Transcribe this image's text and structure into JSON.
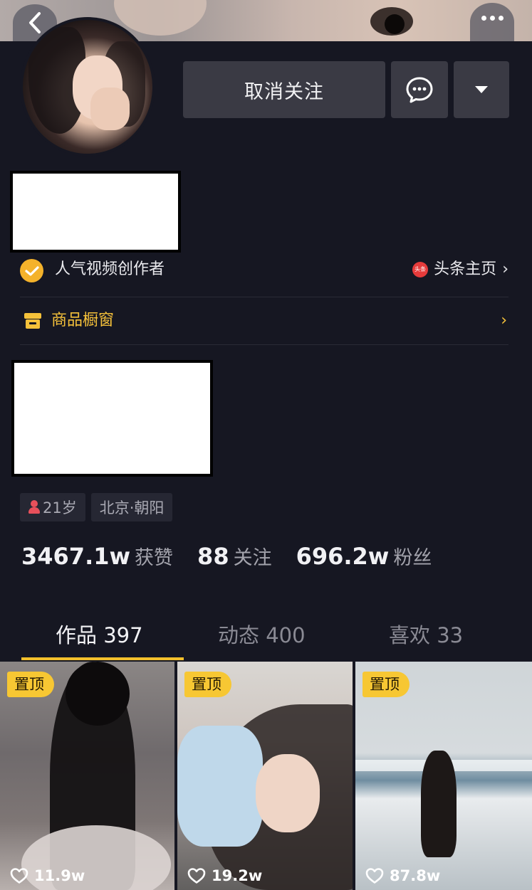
{
  "header": {
    "back_icon": "chevron-left-icon",
    "more_icon": "more-dots-icon"
  },
  "actions": {
    "unfollow_label": "取消关注",
    "message_icon": "chat-bubble-icon",
    "dropdown_icon": "caret-down-icon"
  },
  "profile": {
    "creator_badge": "人气视频创作者",
    "toutiao_icon_text": "头条",
    "toutiao_label": "头条主页",
    "toutiao_chevron": "›",
    "shop_label": "商品橱窗",
    "shop_chevron": "›",
    "tags": {
      "age": "21岁",
      "location": "北京·朝阳"
    }
  },
  "stats": [
    {
      "value": "3467.1w",
      "label": "获赞"
    },
    {
      "value": "88",
      "label": "关注"
    },
    {
      "value": "696.2w",
      "label": "粉丝"
    }
  ],
  "tabs": [
    {
      "label": "作品 397",
      "active": true
    },
    {
      "label": "动态 400",
      "active": false
    },
    {
      "label": "喜欢 33",
      "active": false
    }
  ],
  "videos": [
    {
      "pin": "置顶",
      "likes": "11.9w"
    },
    {
      "pin": "置顶",
      "likes": "19.2w"
    },
    {
      "pin": "置顶",
      "likes": "87.8w"
    }
  ],
  "colors": {
    "background": "#161722",
    "accent": "#f4c02c",
    "button": "#3a3a44"
  }
}
